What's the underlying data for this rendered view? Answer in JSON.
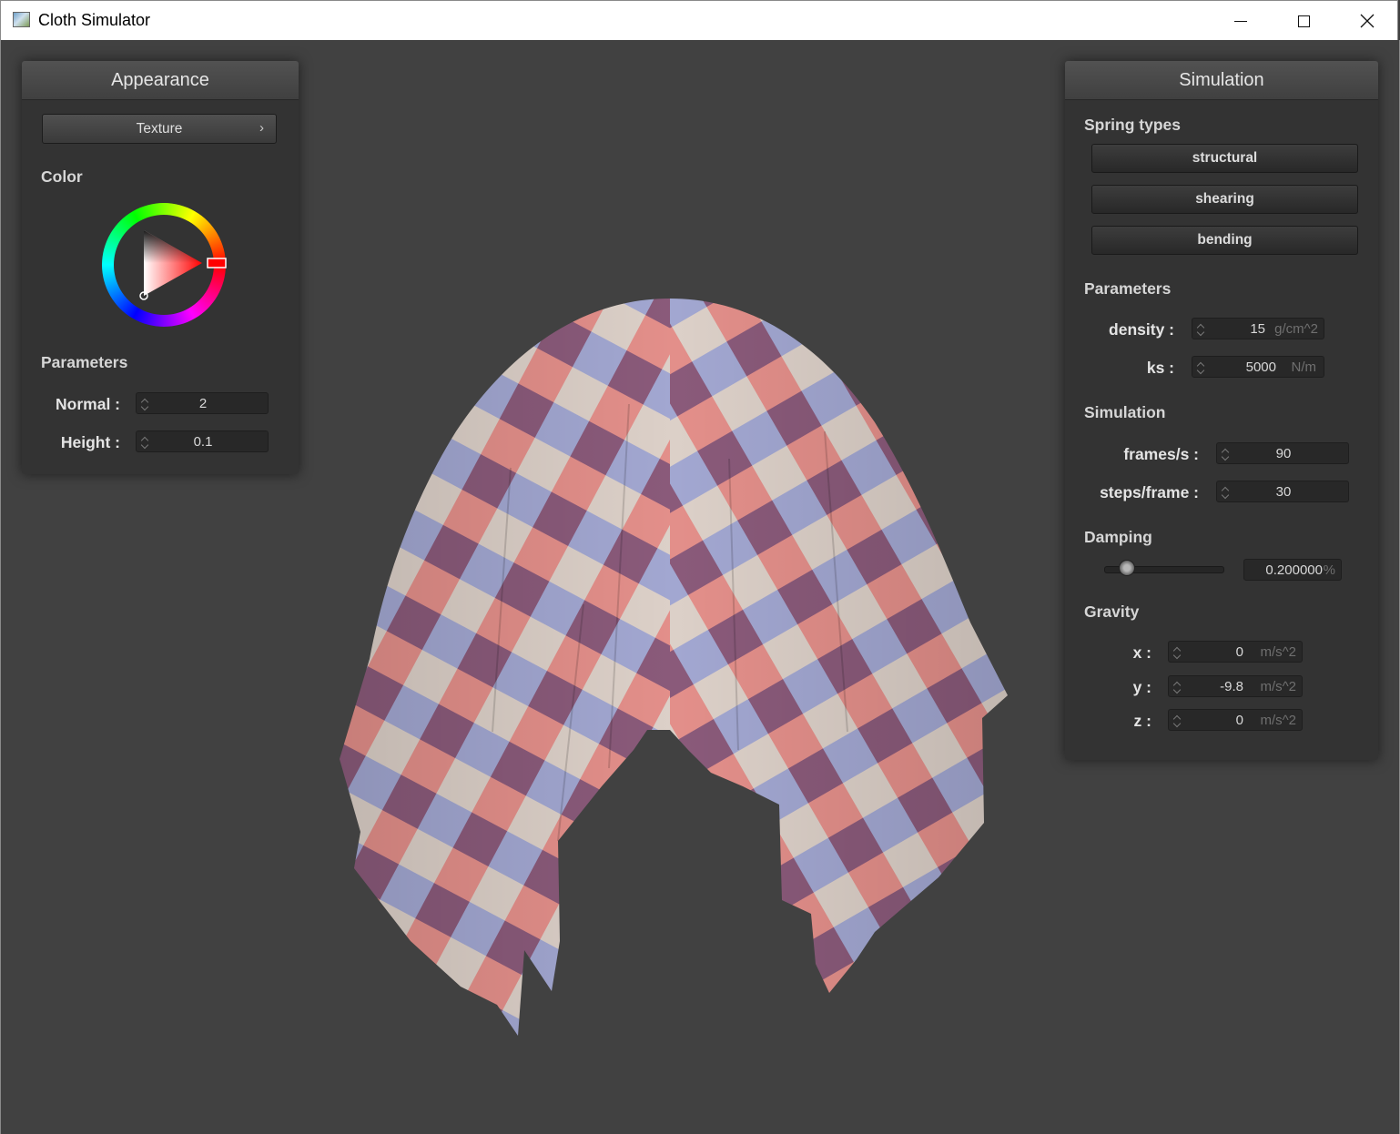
{
  "window": {
    "title": "Cloth Simulator",
    "icon": "app-image-icon"
  },
  "appearance": {
    "title": "Appearance",
    "texture_button": "Texture",
    "texture_chevron": "›",
    "color_label": "Color",
    "selected_color": "#ff0000",
    "parameters_label": "Parameters",
    "normal_label": "Normal :",
    "normal_value": "2",
    "height_label": "Height :",
    "height_value": "0.1"
  },
  "simulation": {
    "title": "Simulation",
    "spring_types_label": "Spring types",
    "spring_types": [
      "structural",
      "shearing",
      "bending"
    ],
    "parameters_label": "Parameters",
    "density_label": "density :",
    "density_value": "15",
    "density_unit": "g/cm^2",
    "ks_label": "ks :",
    "ks_value": "5000",
    "ks_unit": "N/m",
    "simulation_label": "Simulation",
    "fps_label": "frames/s :",
    "fps_value": "90",
    "steps_label": "steps/frame :",
    "steps_value": "30",
    "damping_label": "Damping",
    "damping_value": "0.200000",
    "damping_unit": "%",
    "damping_slider_fraction": 0.12,
    "gravity_label": "Gravity",
    "gx_label": "x :",
    "gx_value": "0",
    "gy_label": "y :",
    "gy_value": "-9.8",
    "gz_label": "z :",
    "gz_value": "0",
    "gravity_unit": "m/s^2"
  },
  "cloth_colors": {
    "red": "#e4847f",
    "blue": "#a3a5d4",
    "purple": "#8c5c7d",
    "cream": "#dcd0c8"
  }
}
